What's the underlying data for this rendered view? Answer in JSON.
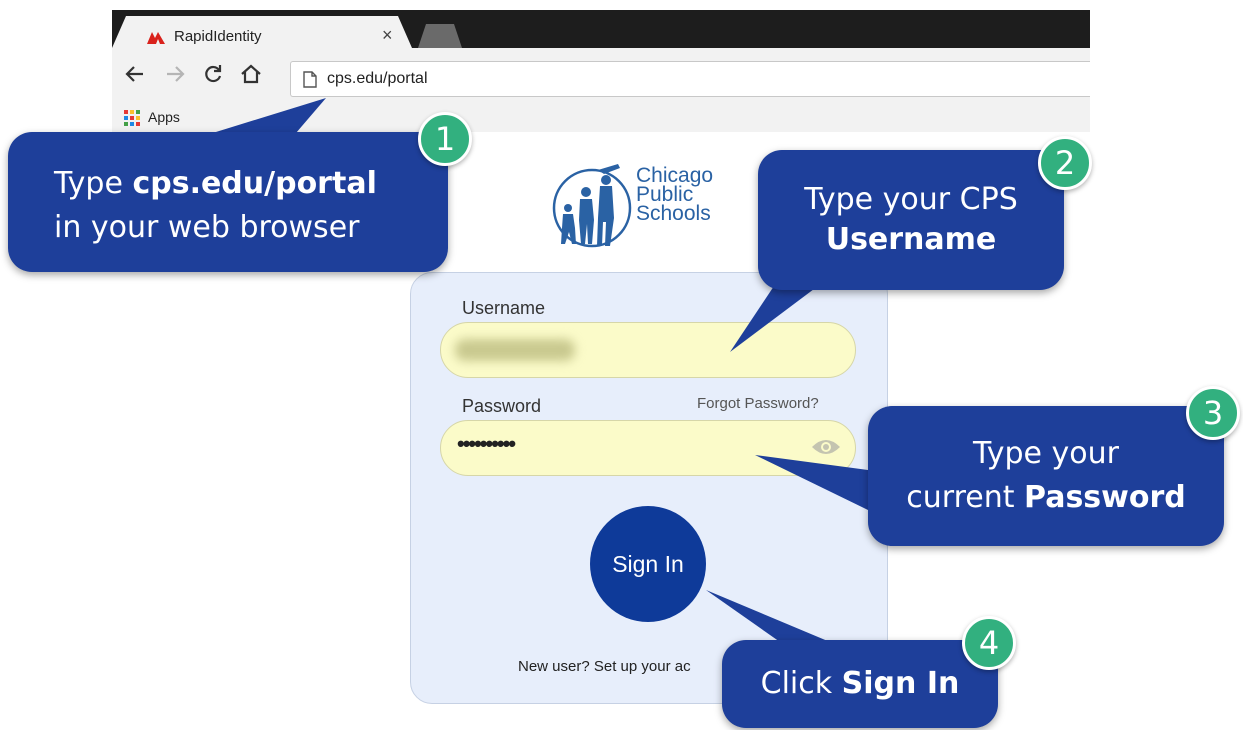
{
  "browser": {
    "tab_title": "RapidIdentity",
    "tab_close": "×",
    "address": "cps.edu/portal",
    "bookmark_label": "Apps"
  },
  "logo": {
    "line1": "Chicago",
    "line2": "Public",
    "line3": "Schools"
  },
  "login": {
    "username_label": "Username",
    "password_label": "Password",
    "forgot_link": "Forgot Password?",
    "password_mask": "••••••••••",
    "signin_label": "Sign In",
    "newuser_text": "New user? Set up your ac"
  },
  "callouts": [
    {
      "number": "1",
      "pre": "Type ",
      "bold": "cps.edu/portal",
      "post": "in your web browser"
    },
    {
      "number": "2",
      "pre": "Type your CPS",
      "bold": "Username",
      "post": ""
    },
    {
      "number": "3",
      "pre": "Type your",
      "mid": "current ",
      "bold": "Password",
      "post": ""
    },
    {
      "number": "4",
      "pre": "Click ",
      "bold": "Sign In",
      "post": ""
    }
  ],
  "colors": {
    "callout_bg": "#1e3f9a",
    "badge_bg": "#32b07f",
    "signin_bg": "#0e3a99",
    "field_bg": "#fbfbc9",
    "card_bg": "#e7eefb"
  }
}
